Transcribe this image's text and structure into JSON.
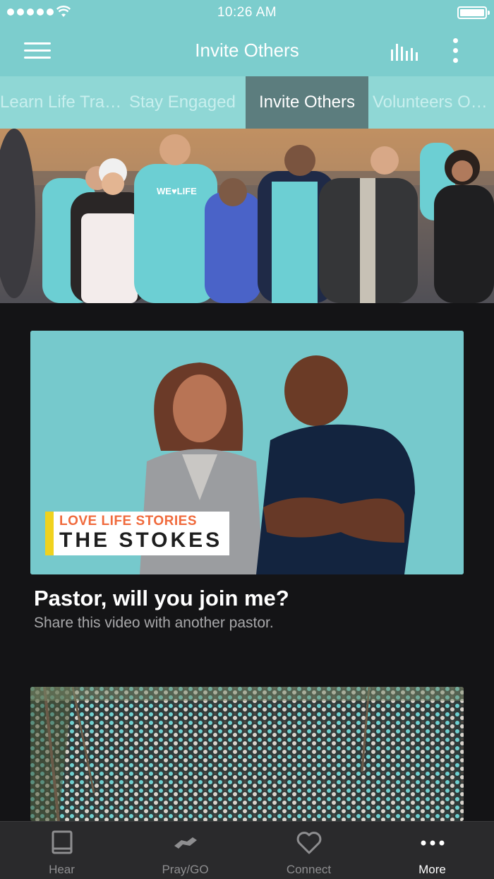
{
  "status_bar": {
    "time": "10:26 AM"
  },
  "header": {
    "title": "Invite Others",
    "menu_icon": "hamburger-icon",
    "chart_icon": "bars-icon",
    "more_icon": "kebab-icon"
  },
  "tabs": [
    {
      "label": "Learn Life Training"
    },
    {
      "label": "Stay Engaged"
    },
    {
      "label": "Invite Others",
      "active": true
    },
    {
      "label": "Volunteers Opportunities"
    }
  ],
  "colors": {
    "header": "#7ccdcd",
    "tabs_bg": "#8fd7d5",
    "active_tab": "#5c7d7e",
    "background": "#141416",
    "badge_yellow": "#f0d21e",
    "badge_orange": "#f06a3c"
  },
  "feed": [
    {
      "badge_top": "LOVE LIFE STORIES",
      "badge_bottom": "THE STOKES",
      "title": "Pastor, will you join me?",
      "subtitle": "Share this video with another pastor."
    }
  ],
  "tabbar": [
    {
      "label": "Hear",
      "icon": "book-icon"
    },
    {
      "label": "Pray/GO",
      "icon": "handshake-icon"
    },
    {
      "label": "Connect",
      "icon": "heart-icon"
    },
    {
      "label": "More",
      "icon": "more-dots-icon",
      "active": true
    }
  ]
}
